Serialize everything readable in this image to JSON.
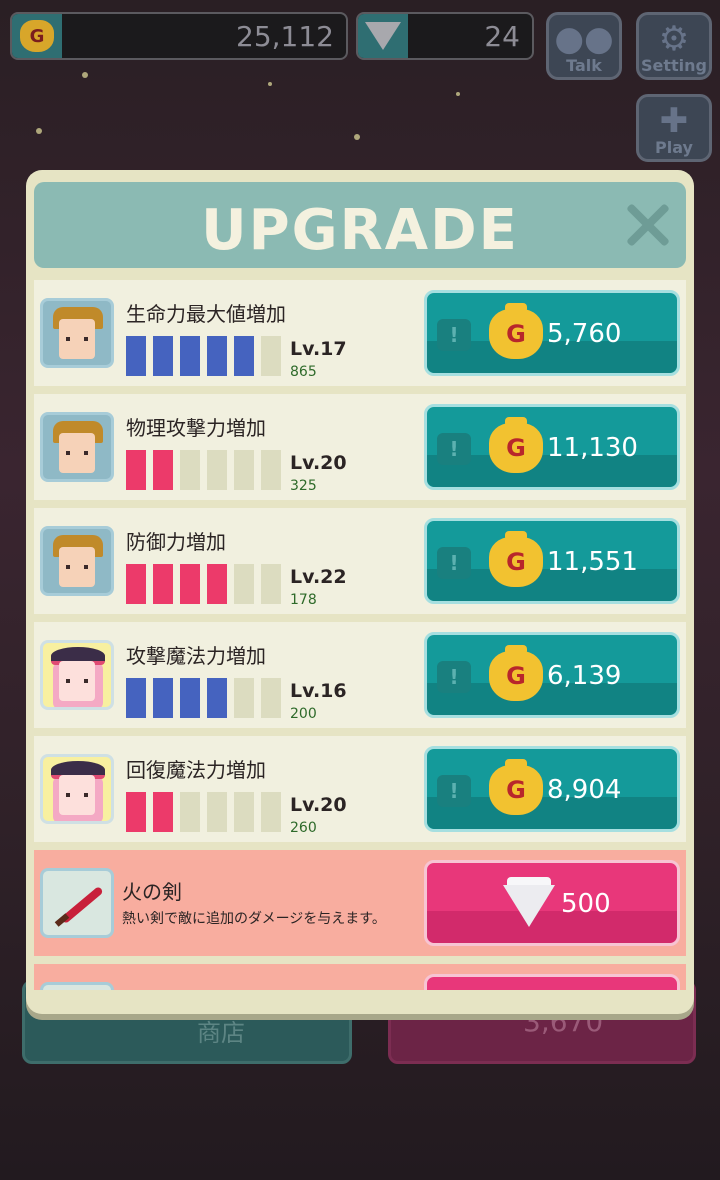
{
  "top_bar": {
    "gold": "25,112",
    "gems": "24"
  },
  "side_buttons": {
    "talk": "Talk",
    "setting": "Setting",
    "play": "Play"
  },
  "background_buttons": {
    "shop_label": "商店",
    "gold_value": "3,670"
  },
  "modal": {
    "title": "UPGRADE",
    "close_icon": "close-icon",
    "rows": [
      {
        "type": "stat",
        "avatar": "knight",
        "name": "生命力最大値増加",
        "level": "Lv.17",
        "value": "865",
        "bar_color": "#4563bf",
        "filled": 5,
        "total": 6,
        "cost": "5,760",
        "currency": "gold"
      },
      {
        "type": "stat",
        "avatar": "knight",
        "name": "物理攻撃力増加",
        "level": "Lv.20",
        "value": "325",
        "bar_color": "#ec3a6a",
        "filled": 2,
        "total": 6,
        "cost": "11,130",
        "currency": "gold"
      },
      {
        "type": "stat",
        "avatar": "knight",
        "name": "防御力増加",
        "level": "Lv.22",
        "value": "178",
        "bar_color": "#ec3a6a",
        "filled": 4,
        "total": 6,
        "cost": "11,551",
        "currency": "gold"
      },
      {
        "type": "stat",
        "avatar": "witch",
        "name": "攻撃魔法力増加",
        "level": "Lv.16",
        "value": "200",
        "bar_color": "#4563bf",
        "filled": 4,
        "total": 6,
        "cost": "6,139",
        "currency": "gold"
      },
      {
        "type": "stat",
        "avatar": "witch",
        "name": "回復魔法力増加",
        "level": "Lv.20",
        "value": "260",
        "bar_color": "#ec3a6a",
        "filled": 2,
        "total": 6,
        "cost": "8,904",
        "currency": "gold"
      },
      {
        "type": "item",
        "avatar": "sword",
        "name": "火の剣",
        "description": "熱い剣で敵に追加のダメージを与えます。",
        "cost": "500",
        "currency": "gem"
      }
    ]
  },
  "colors": {
    "modal_bg": "#e6e4c4",
    "header_bg": "#8bbab3",
    "gold_button": "#149a9a",
    "gem_button": "#e8377a",
    "item_row": "#f8ad9f"
  }
}
